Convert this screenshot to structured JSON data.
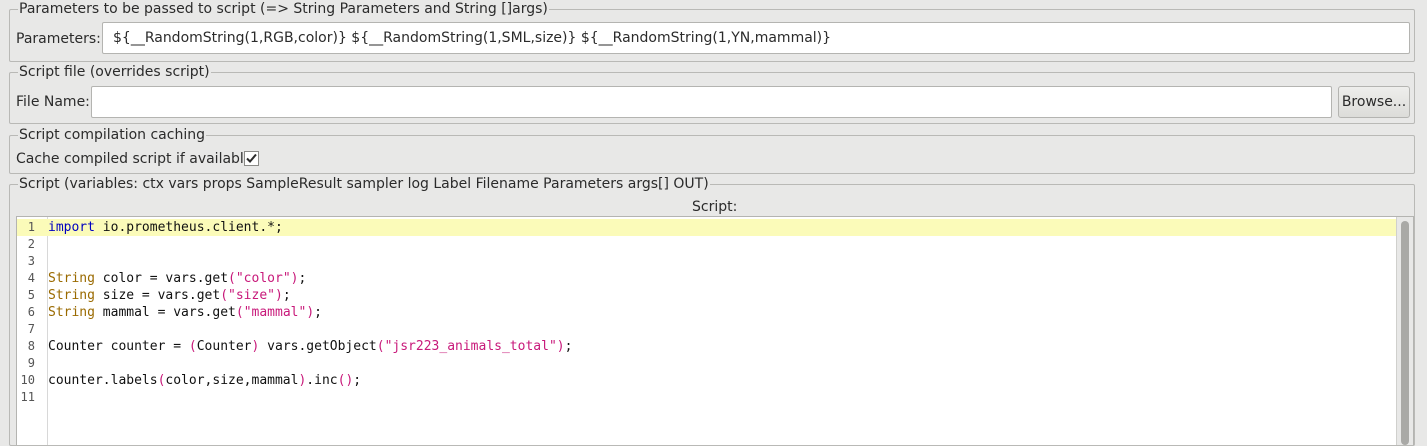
{
  "params_group": {
    "legend": "Parameters to be passed to script (=> String Parameters and String []args)",
    "label": "Parameters:",
    "value": "${__RandomString(1,RGB,color)} ${__RandomString(1,SML,size)} ${__RandomString(1,YN,mammal)}"
  },
  "file_group": {
    "legend": "Script file (overrides script)",
    "label": "File Name:",
    "value": "",
    "browse_label": "Browse..."
  },
  "cache_group": {
    "legend": "Script compilation caching",
    "label": "Cache compiled script if available:",
    "checked": true
  },
  "script_group": {
    "legend": "Script (variables: ctx vars props SampleResult sampler log Label Filename Parameters args[] OUT)",
    "editor_title": "Script:",
    "line_numbers": [
      "1",
      "2",
      "3",
      "4",
      "5",
      "6",
      "7",
      "8",
      "9",
      "10",
      "11"
    ],
    "lines": [
      "import io.prometheus.client.*;",
      "",
      "",
      "String color = vars.get(\"color\");",
      "String size = vars.get(\"size\");",
      "String mammal = vars.get(\"mammal\");",
      "",
      "Counter counter = (Counter) vars.getObject(\"jsr223_animals_total\");",
      "",
      "counter.labels(color,size,mammal).inc();",
      ""
    ]
  },
  "colors": {
    "background": "#e8e8e7",
    "current_line": "#fbfbb9",
    "keyword": "#0000c0",
    "type": "#9a6a00",
    "string": "#c8197a"
  }
}
